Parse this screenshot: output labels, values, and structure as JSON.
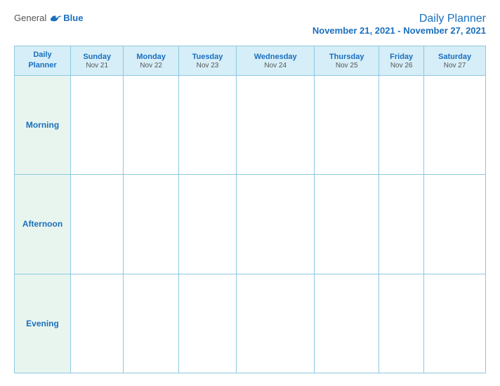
{
  "logo": {
    "general": "General",
    "blue": "Blue"
  },
  "header": {
    "title": "Daily Planner",
    "date_range": "November 21, 2021 - November 27, 2021"
  },
  "table": {
    "corner_label_line1": "Daily",
    "corner_label_line2": "Planner",
    "columns": [
      {
        "day": "Sunday",
        "date": "Nov 21"
      },
      {
        "day": "Monday",
        "date": "Nov 22"
      },
      {
        "day": "Tuesday",
        "date": "Nov 23"
      },
      {
        "day": "Wednesday",
        "date": "Nov 24"
      },
      {
        "day": "Thursday",
        "date": "Nov 25"
      },
      {
        "day": "Friday",
        "date": "Nov 26"
      },
      {
        "day": "Saturday",
        "date": "Nov 27"
      }
    ],
    "rows": [
      {
        "label": "Morning"
      },
      {
        "label": "Afternoon"
      },
      {
        "label": "Evening"
      }
    ]
  }
}
